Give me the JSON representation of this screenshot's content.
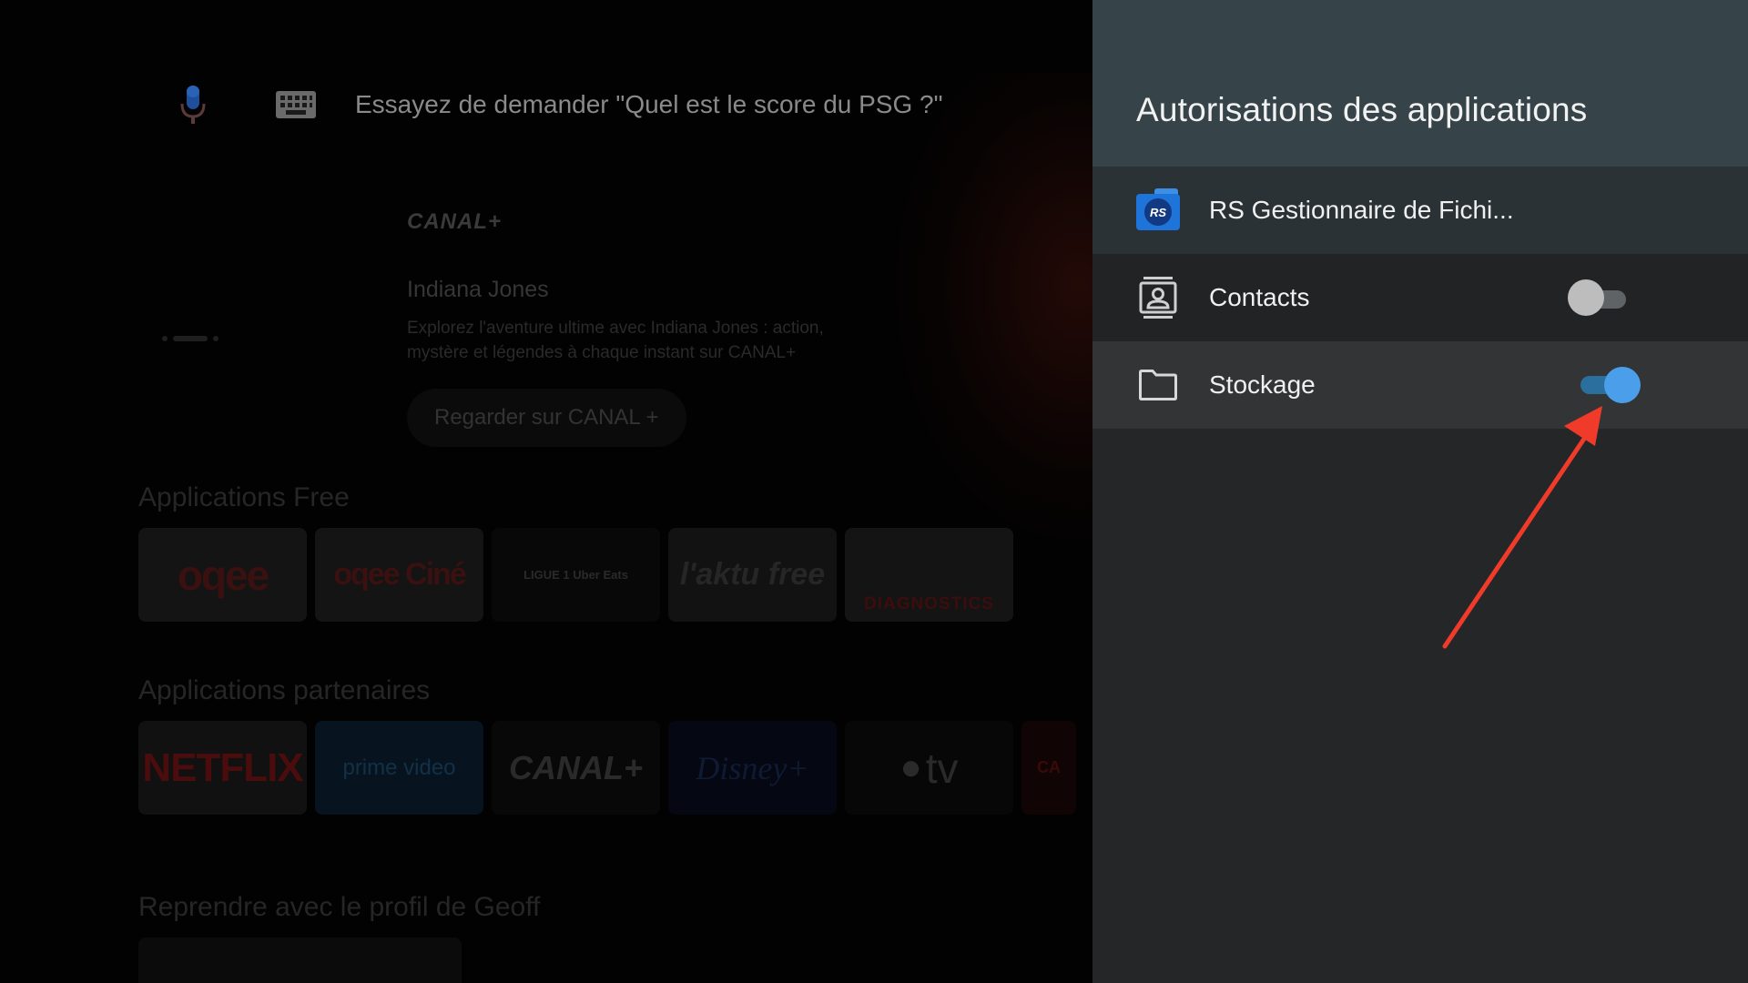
{
  "home": {
    "voice_hint": "Essayez de demander \"Quel est le score du PSG ?\"",
    "hero": {
      "brand": "CANAL+",
      "title": "Indiana Jones",
      "description": "Explorez l'aventure ultime avec Indiana Jones : action, mystère et légendes à chaque instant sur CANAL+",
      "button": "Regarder sur CANAL +"
    },
    "rows": {
      "free_title": "Applications Free",
      "free_tiles": [
        "oqee",
        "oqee Ciné",
        "LIGUE 1 Uber Eats",
        "l'aktu free",
        "DIAGNOSTICS"
      ],
      "partners_title": "Applications partenaires",
      "partner_tiles": [
        "NETFLIX",
        "prime video",
        "CANAL+",
        "Disney+",
        "tv",
        "CA"
      ],
      "resume_title": "Reprendre avec le profil de Geoff"
    }
  },
  "panel": {
    "title": "Autorisations des applications",
    "app_name": "RS Gestionnaire de Fichi...",
    "app_icon_text": "RS",
    "permissions": [
      {
        "label": "Contacts",
        "enabled": false
      },
      {
        "label": "Stockage",
        "enabled": true
      }
    ]
  },
  "colors": {
    "panel_background": "#242628",
    "panel_header": "#364449",
    "switch_on": "#4a9eea",
    "switch_off": "#bdbdbd",
    "annotation_arrow": "#f03a2a"
  },
  "icons": {
    "mic": "mic-icon",
    "keyboard": "keyboard-icon",
    "contacts": "contacts-icon",
    "storage": "folder-icon"
  }
}
